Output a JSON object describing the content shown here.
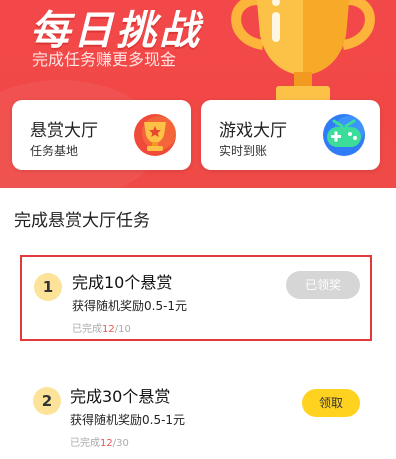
{
  "header": {
    "title": "每日挑战",
    "subtitle": "完成任务赚更多现金"
  },
  "cards": [
    {
      "title": "悬赏大厅",
      "subtitle": "任务基地",
      "icon": "trophy-badge-icon"
    },
    {
      "title": "游戏大厅",
      "subtitle": "实时到账",
      "icon": "gamepad-icon"
    }
  ],
  "section": {
    "title": "完成悬赏大厅任务"
  },
  "tasks": [
    {
      "index": "1",
      "title": "完成10个悬赏",
      "reward": "获得随机奖励0.5-1元",
      "progress_prefix": "已完成",
      "progress_current": "12",
      "progress_total": "/10",
      "button": "已领奖",
      "status": "claimed"
    },
    {
      "index": "2",
      "title": "完成30个悬赏",
      "reward": "获得随机奖励0.5-1元",
      "progress_prefix": "已完成",
      "progress_current": "12",
      "progress_total": "/30",
      "button": "领取",
      "status": "claimable"
    }
  ],
  "colors": {
    "header_bg": "#f2484a",
    "claim_button": "#ffd21f",
    "claimed_button": "#d6d6d6",
    "number_badge": "#fde39a",
    "selection_border": "#e23a3a"
  }
}
